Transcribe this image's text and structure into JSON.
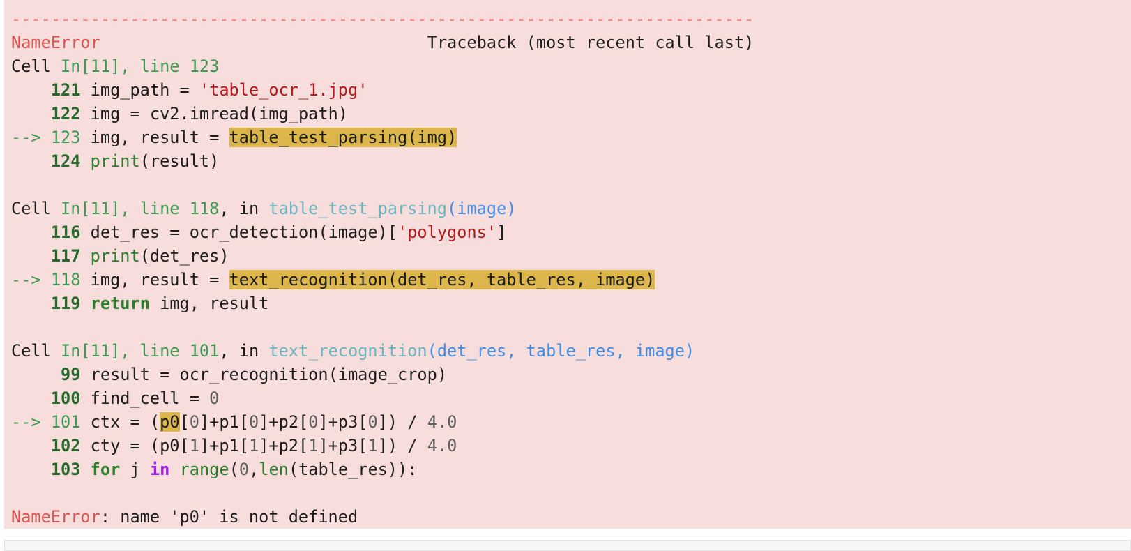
{
  "traceback": {
    "separator": "---------------------------------------------------------------------------",
    "error_name": "NameError",
    "header_right": "Traceback (most recent call last)",
    "frames": [
      {
        "cell_word": "Cell",
        "cell_ref": "In[11], line 123",
        "lines": [
          {
            "no": "121",
            "arrow": false,
            "code": "img_path = 'table_ocr_1.jpg'"
          },
          {
            "no": "122",
            "arrow": false,
            "code": "img = cv2.imread(img_path)"
          },
          {
            "no": "123",
            "arrow": true,
            "code": "img, result = table_test_parsing(img)"
          },
          {
            "no": "124",
            "arrow": false,
            "code": "print(result)"
          }
        ]
      },
      {
        "cell_word": "Cell",
        "cell_ref": "In[11], line 118",
        "in_word": ", in ",
        "func_name": "table_test_parsing",
        "func_args": "(image)",
        "lines": [
          {
            "no": "116",
            "arrow": false,
            "code": "det_res = ocr_detection(image)['polygons']"
          },
          {
            "no": "117",
            "arrow": false,
            "code": "print(det_res)"
          },
          {
            "no": "118",
            "arrow": true,
            "code": "img, result = text_recognition(det_res, table_res, image)"
          },
          {
            "no": "119",
            "arrow": false,
            "code": "return img, result"
          }
        ]
      },
      {
        "cell_word": "Cell",
        "cell_ref": "In[11], line 101",
        "in_word": ", in ",
        "func_name": "text_recognition",
        "func_args": "(det_res, table_res, image)",
        "lines": [
          {
            "no": "99",
            "arrow": false,
            "code": "result = ocr_recognition(image_crop)"
          },
          {
            "no": "100",
            "arrow": false,
            "code": "find_cell = 0"
          },
          {
            "no": "101",
            "arrow": true,
            "code": "ctx = (p0[0]+p1[0]+p2[0]+p3[0]) / 4.0"
          },
          {
            "no": "102",
            "arrow": false,
            "code": "cty = (p0[1]+p1[1]+p2[1]+p3[1]) / 4.0"
          },
          {
            "no": "103",
            "arrow": false,
            "code": "for j in range(0,len(table_res)):"
          }
        ]
      }
    ],
    "final_error_name": "NameError",
    "final_message": ": name 'p0' is not defined"
  },
  "colors": {
    "output_background": "#f8dddd",
    "error_red": "#d9534f",
    "highlight": "#dcb64a",
    "line_number_green": "#256a2a",
    "string_red": "#b51a1a",
    "function_teal": "#6ab6c0",
    "param_blue": "#3f8ee8",
    "keyword_purple": "#a120e6"
  }
}
